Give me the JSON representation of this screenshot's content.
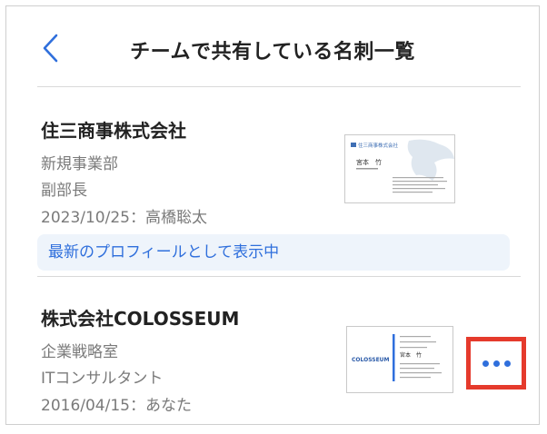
{
  "header": {
    "title": "チームで共有している名刺一覧"
  },
  "cards": [
    {
      "company": "住三商事株式会社",
      "department": "新規事業部",
      "position": "副部長",
      "exchange": "2023/10/25：高橋聡太",
      "status": "最新のプロフィールとして表示中",
      "thumb": {
        "company": "住三商事株式会社",
        "name": "宮本　竹"
      }
    },
    {
      "company": "株式会社COLOSSEUM",
      "department": "企業戦略室",
      "position": "ITコンサルタント",
      "exchange": "2016/04/15：あなた",
      "thumb": {
        "logo": "COLOSSEUM",
        "name": "宮本　竹"
      }
    }
  ],
  "colors": {
    "accent": "#2f6fdc",
    "highlight": "#e53a2c"
  }
}
